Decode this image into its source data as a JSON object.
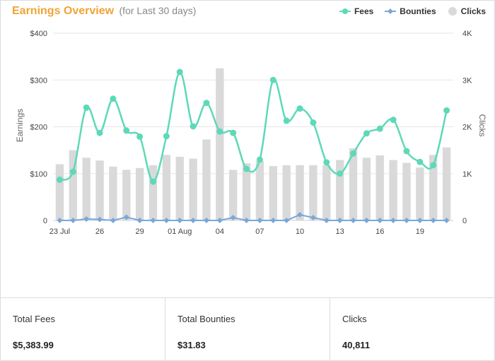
{
  "header": {
    "title": "Earnings Overview",
    "subtitle": "(for Last 30 days)"
  },
  "legend": [
    {
      "label": "Fees",
      "color": "#5dd9b8",
      "marker": "circle"
    },
    {
      "label": "Bounties",
      "color": "#7aa7d8",
      "marker": "diamond"
    },
    {
      "label": "Clicks",
      "color": "#d9d9d9",
      "marker": "circle"
    }
  ],
  "chart_data": {
    "type": "bar+line",
    "x": [
      "23 Jul",
      "24 Jul",
      "25 Jul",
      "26 Jul",
      "27 Jul",
      "28 Jul",
      "29 Jul",
      "30 Jul",
      "31 Jul",
      "01 Aug",
      "02 Aug",
      "03 Aug",
      "04 Aug",
      "05 Aug",
      "06 Aug",
      "07 Aug",
      "08 Aug",
      "09 Aug",
      "10 Aug",
      "11 Aug",
      "12 Aug",
      "13 Aug",
      "14 Aug",
      "15 Aug",
      "16 Aug",
      "17 Aug",
      "18 Aug",
      "19 Aug",
      "20 Aug",
      "21 Aug"
    ],
    "xticks": [
      {
        "index": 0,
        "label": "23 Jul"
      },
      {
        "index": 3,
        "label": "26"
      },
      {
        "index": 6,
        "label": "29"
      },
      {
        "index": 9,
        "label": "01 Aug"
      },
      {
        "index": 12,
        "label": "04"
      },
      {
        "index": 15,
        "label": "07"
      },
      {
        "index": 18,
        "label": "10"
      },
      {
        "index": 21,
        "label": "13"
      },
      {
        "index": 24,
        "label": "16"
      },
      {
        "index": 27,
        "label": "19"
      }
    ],
    "left_axis": {
      "ylabel": "Earnings",
      "ylim": [
        0,
        400
      ],
      "ticks": [
        "0",
        "$100",
        "$200",
        "$300",
        "$400"
      ]
    },
    "right_axis": {
      "ylabel": "Clicks",
      "ylim": [
        0,
        4000
      ],
      "ticks": [
        "0",
        "1K",
        "2K",
        "3K",
        "4K"
      ]
    },
    "grid": true,
    "series": [
      {
        "name": "Clicks",
        "type": "bar",
        "axis": "right",
        "color": "#d9d9d9",
        "values": [
          1200,
          1500,
          1340,
          1280,
          1150,
          1080,
          1120,
          1180,
          1400,
          1360,
          1320,
          1730,
          3250,
          1080,
          1220,
          1270,
          1160,
          1180,
          1180,
          1180,
          1180,
          1290,
          1540,
          1340,
          1390,
          1290,
          1230,
          1130,
          1400,
          1560
        ]
      },
      {
        "name": "Fees",
        "type": "line",
        "axis": "left",
        "color": "#5dd9b8",
        "values": [
          87,
          104,
          241,
          187,
          260,
          192,
          179,
          83,
          180,
          317,
          201,
          251,
          190,
          187,
          110,
          130,
          300,
          213,
          239,
          209,
          124,
          100,
          143,
          186,
          196,
          215,
          148,
          125,
          118,
          235
        ]
      },
      {
        "name": "Bounties",
        "type": "line",
        "axis": "left",
        "color": "#7aa7d8",
        "values": [
          0,
          0,
          3,
          2,
          0,
          7,
          0,
          0,
          0,
          0,
          0,
          0,
          0,
          6,
          0,
          0,
          0,
          0,
          12,
          6,
          0,
          0,
          0,
          0,
          0,
          0,
          0,
          0,
          0,
          0
        ]
      }
    ]
  },
  "stats": [
    {
      "label": "Total Fees",
      "value": "$5,383.99"
    },
    {
      "label": "Total Bounties",
      "value": "$31.83"
    },
    {
      "label": "Clicks",
      "value": "40,811"
    }
  ]
}
